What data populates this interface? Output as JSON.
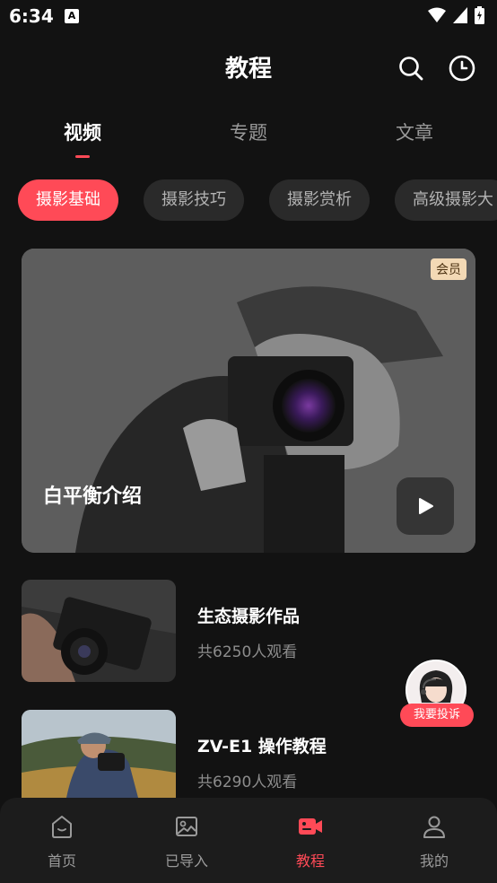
{
  "status_bar": {
    "time": "6:34",
    "badge": "A"
  },
  "header": {
    "title": "教程"
  },
  "tabs": [
    {
      "label": "视频",
      "active": true
    },
    {
      "label": "专题",
      "active": false
    },
    {
      "label": "文章",
      "active": false
    }
  ],
  "chips": [
    {
      "label": "摄影基础",
      "active": true
    },
    {
      "label": "摄影技巧",
      "active": false
    },
    {
      "label": "摄影赏析",
      "active": false
    },
    {
      "label": "高级摄影大",
      "active": false
    }
  ],
  "hero": {
    "badge": "会员",
    "title": "白平衡介绍"
  },
  "list": [
    {
      "title": "生态摄影作品",
      "subtitle": "共6250人观看"
    },
    {
      "title": "ZV-E1 操作教程",
      "subtitle": "共6290人观看"
    }
  ],
  "support": {
    "label": "我要投诉"
  },
  "bottom_nav": [
    {
      "label": "首页",
      "icon": "home-icon",
      "active": false
    },
    {
      "label": "已导入",
      "icon": "image-icon",
      "active": false
    },
    {
      "label": "教程",
      "icon": "video-camera-icon",
      "active": true
    },
    {
      "label": "我的",
      "icon": "person-icon",
      "active": false
    }
  ],
  "colors": {
    "accent": "#ff4a57",
    "background": "#121212",
    "nav_background": "#1c1c1c"
  }
}
